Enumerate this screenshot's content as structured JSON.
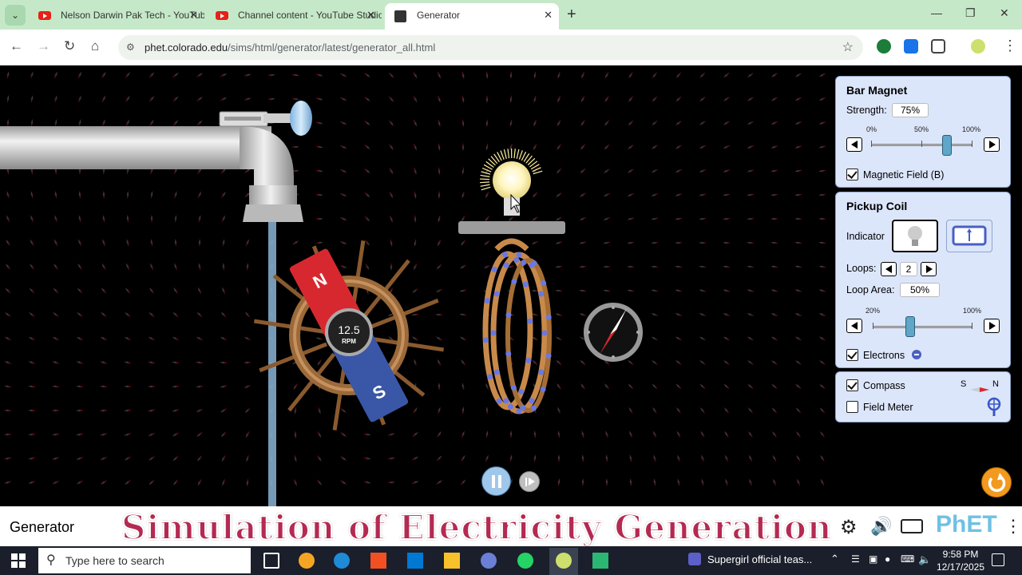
{
  "browser": {
    "tabs": [
      {
        "title": "Nelson Darwin Pak Tech - YouTube",
        "active": false
      },
      {
        "title": "Channel content - YouTube Studio",
        "active": false
      },
      {
        "title": "Generator",
        "active": true
      }
    ],
    "url_domain": "phet.colorado.edu",
    "url_path": "/sims/html/generator/latest/generator_all.html"
  },
  "sim": {
    "rpm_value": "12.5",
    "rpm_unit": "RPM",
    "magnet_n": "N",
    "magnet_s": "S"
  },
  "bar_magnet": {
    "title": "Bar Magnet",
    "strength_label": "Strength:",
    "strength_value": "75%",
    "tick_min": "0%",
    "tick_mid": "50%",
    "tick_max": "100%",
    "strength_fraction": 0.75,
    "magnetic_field_label": "Magnetic Field (B)",
    "magnetic_field_checked": true
  },
  "pickup_coil": {
    "title": "Pickup Coil",
    "indicator_label": "Indicator",
    "loops_label": "Loops:",
    "loops_value": "2",
    "loop_area_label": "Loop Area:",
    "loop_area_value": "50%",
    "tick_min": "20%",
    "tick_max": "100%",
    "loop_area_fraction": 0.375,
    "electrons_label": "Electrons",
    "electrons_checked": true
  },
  "tools": {
    "compass_label": "Compass",
    "compass_checked": true,
    "compass_legend_s": "S",
    "compass_legend_n": "N",
    "field_meter_label": "Field Meter",
    "field_meter_checked": false
  },
  "navbar": {
    "sim_name": "Generator",
    "overlay_caption": "Simulation of Electricity Generation",
    "brand": "PhET"
  },
  "taskbar": {
    "search_placeholder": "Type here to search",
    "media_title": "Supergirl official teas...",
    "time": "9:58 PM",
    "date": "12/17/2025"
  },
  "colors": {
    "tab_bar": "#c5e9c8",
    "panel_bg": "#dce6fb",
    "caption": "#b42a52",
    "magnet_north": "#d7282f",
    "magnet_south": "#3a56a6"
  }
}
